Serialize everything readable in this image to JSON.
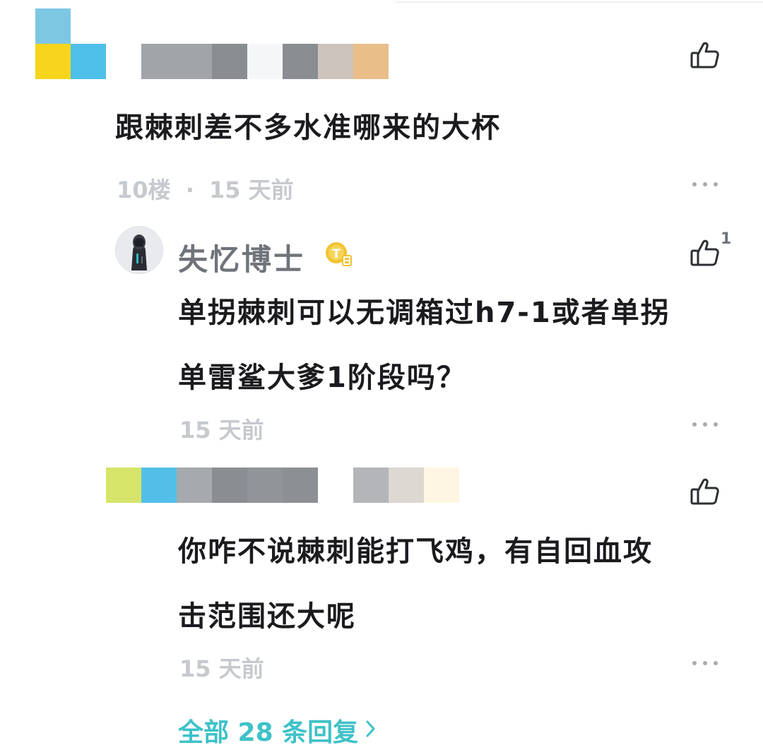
{
  "comment": {
    "text": "跟棘刺差不多水准哪来的大杯",
    "floor": "10楼",
    "separator": "·",
    "time": "15 天前"
  },
  "reply1": {
    "author": "失忆博士",
    "likes": "1",
    "text_line1": "单拐棘刺可以无调箱过h7-1或者单拐",
    "text_line2": "单雷鲨大爹1阶段吗？",
    "time": "15 天前"
  },
  "reply2": {
    "text_line1": "你咋不说棘刺能打飞鸡，有自回血攻",
    "text_line2": "击范围还大呢",
    "time": "15 天前"
  },
  "footer": {
    "all_replies": "全部 28 条回复"
  },
  "icons": {
    "like": "thumbs-up-icon",
    "more": "more-dots-icon",
    "chevron": "chevron-right-icon",
    "badge": "level-badge-icon"
  },
  "colors": {
    "accent": "#3ec2c8",
    "text": "#1b1b1f",
    "meta": "#c6c9cd",
    "badge": "#f2c230"
  }
}
